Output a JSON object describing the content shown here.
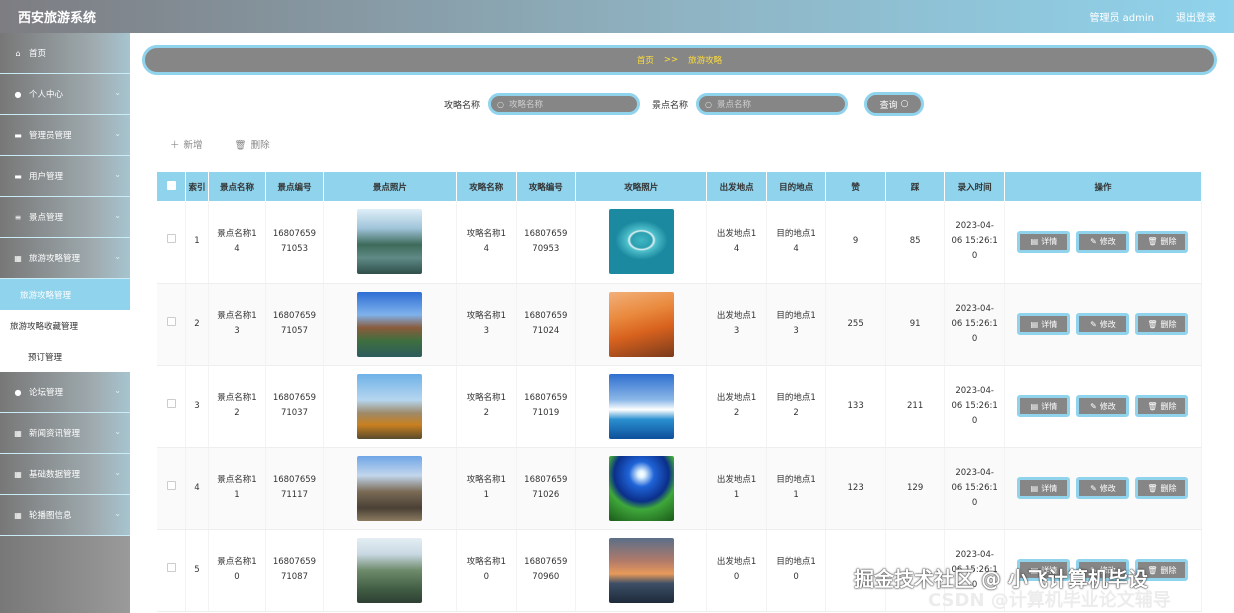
{
  "header": {
    "title": "西安旅游系统",
    "user": "管理员 admin",
    "logout": "退出登录"
  },
  "sidebar": {
    "items": [
      {
        "label": "首页",
        "icon": "home-icon",
        "glyph": "⌂",
        "arrow": false
      },
      {
        "label": "个人中心",
        "icon": "user-icon",
        "glyph": "●",
        "arrow": true
      },
      {
        "label": "管理员管理",
        "icon": "card-icon",
        "glyph": "▬",
        "arrow": true
      },
      {
        "label": "用户管理",
        "icon": "card-icon",
        "glyph": "▬",
        "arrow": true
      },
      {
        "label": "景点管理",
        "icon": "list-icon",
        "glyph": "≡",
        "arrow": true
      },
      {
        "label": "旅游攻略管理",
        "icon": "grid-icon",
        "glyph": "▦",
        "arrow": true
      }
    ],
    "sub": [
      "旅游攻略管理",
      "旅游攻略收藏管理",
      "预订管理"
    ],
    "items2": [
      {
        "label": "论坛管理",
        "icon": "bulb-icon",
        "glyph": "●",
        "arrow": true
      },
      {
        "label": "新闻资讯管理",
        "icon": "grid-icon",
        "glyph": "▦",
        "arrow": true
      },
      {
        "label": "基础数据管理",
        "icon": "grid-icon",
        "glyph": "▦",
        "arrow": true
      },
      {
        "label": "轮播图信息",
        "icon": "grid-icon",
        "glyph": "▦",
        "arrow": true
      }
    ]
  },
  "breadcrumb": {
    "home": "首页",
    "sep": ">>",
    "current": "旅游攻略"
  },
  "search": {
    "label1": "攻略名称",
    "placeholder1": "攻略名称",
    "label2": "景点名称",
    "placeholder2": "景点名称",
    "button": "查询"
  },
  "actions": {
    "add": "新增",
    "delete": "删除"
  },
  "table": {
    "headers": [
      "索引",
      "景点名称",
      "景点编号",
      "景点照片",
      "攻略名称",
      "攻略编号",
      "攻略照片",
      "出发地点",
      "目的地点",
      "赞",
      "踩",
      "录入时间",
      "操作"
    ],
    "ops": {
      "detail": "详情",
      "edit": "修改",
      "delete": "删除"
    },
    "rows": [
      {
        "idx": "1",
        "scenic_name": "景点名称1\n4",
        "scenic_no": "16807659\n71053",
        "guide_name": "攻略名称1\n4",
        "guide_no": "16807659\n70953",
        "from": "出发地点1\n4",
        "to": "目的地点1\n4",
        "likes": "9",
        "dislikes": "85",
        "time": "2023-04-\n06 15:26:1\n0",
        "img1": "lake",
        "img2": "heart"
      },
      {
        "idx": "2",
        "scenic_name": "景点名称1\n3",
        "scenic_no": "16807659\n71057",
        "guide_name": "攻略名称1\n3",
        "guide_no": "16807659\n71024",
        "from": "出发地点1\n3",
        "to": "目的地点1\n3",
        "likes": "255",
        "dislikes": "91",
        "time": "2023-04-\n06 15:26:1\n0",
        "img1": "pagoda",
        "img2": "desert"
      },
      {
        "idx": "3",
        "scenic_name": "景点名称1\n2",
        "scenic_no": "16807659\n71037",
        "guide_name": "攻略名称1\n2",
        "guide_no": "16807659\n71019",
        "from": "出发地点1\n2",
        "to": "目的地点1\n2",
        "likes": "133",
        "dislikes": "211",
        "time": "2023-04-\n06 15:26:1\n0",
        "img1": "tower",
        "img2": "sea"
      },
      {
        "idx": "4",
        "scenic_name": "景点名称1\n1",
        "scenic_no": "16807659\n71117",
        "guide_name": "攻略名称1\n1",
        "guide_no": "16807659\n71026",
        "from": "出发地点1\n1",
        "to": "目的地点1\n1",
        "likes": "123",
        "dislikes": "129",
        "time": "2023-04-\n06 15:26:1\n0",
        "img1": "gate",
        "img2": "field"
      },
      {
        "idx": "5",
        "scenic_name": "景点名称1\n0",
        "scenic_no": "16807659\n71087",
        "guide_name": "攻略名称1\n0",
        "guide_no": "16807659\n70960",
        "from": "出发地点1\n0",
        "to": "目的地点1\n0",
        "likes": "",
        "dislikes": "",
        "time": "2023-04-\n06 15:26:1\n0",
        "img1": "mountain",
        "img2": "sunset"
      }
    ]
  },
  "watermark": {
    "line1": "掘金技术社区 @ 小飞计算机毕设",
    "line2": "CSDN @计算机毕业论文辅导"
  },
  "colors": {
    "accent": "#8fd3ec",
    "gray": "#868686",
    "crumb_text": "#ffde3b"
  }
}
